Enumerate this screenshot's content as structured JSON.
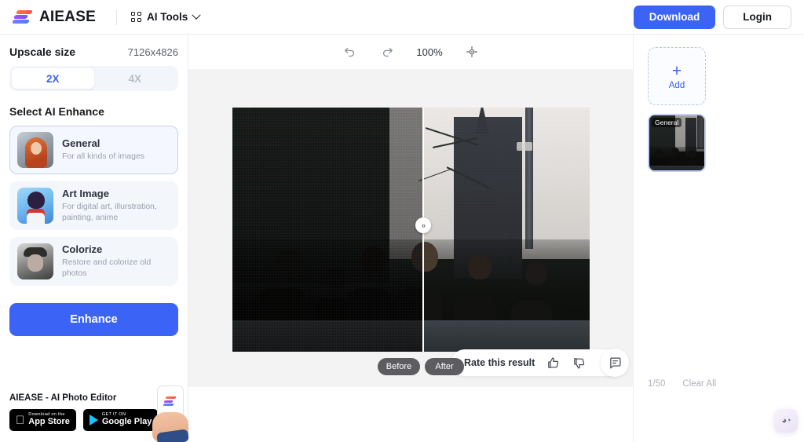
{
  "header": {
    "brand": "AIEASE",
    "logo_icon": "aiease-logo-icon",
    "ai_tools_label": "AI Tools",
    "ai_tools_icon": "grid-icon",
    "chevron_icon": "chevron-down-icon",
    "download_label": "Download",
    "login_label": "Login",
    "accent_color": "#3b64f6"
  },
  "left_panel": {
    "upscale_size_label": "Upscale size",
    "upscale_size_value": "7126x4826",
    "scale_options": [
      {
        "label": "2X",
        "selected": true
      },
      {
        "label": "4X",
        "selected": false
      }
    ],
    "select_enhance_label": "Select AI Enhance",
    "enhance_models": [
      {
        "name": "General",
        "desc": "For all kinds of images",
        "thumb_icon": "portrait-woman-thumb",
        "selected": true
      },
      {
        "name": "Art Image",
        "desc": "For digital art, illurstration, painting, anime",
        "thumb_icon": "anime-girl-thumb",
        "selected": false
      },
      {
        "name": "Colorize",
        "desc": "Restore and colorize old photos",
        "thumb_icon": "old-man-photo-thumb",
        "selected": false
      }
    ],
    "enhance_button": "Enhance",
    "promo": {
      "title": "AIEASE - AI Photo Editor",
      "app_store": {
        "small": "Download on the",
        "big": "App Store",
        "icon": "apple-icon"
      },
      "google_play": {
        "small": "GET IT ON",
        "big": "Google Play",
        "icon": "google-play-icon"
      },
      "phone_art_icon": "hand-holding-phone-icon"
    }
  },
  "canvas": {
    "toolbar": {
      "undo_icon": "undo-icon",
      "redo_icon": "redo-icon",
      "zoom_level": "100%",
      "fit_icon": "fit-to-screen-icon"
    },
    "compare": {
      "before_label": "Before",
      "after_label": "After",
      "handle_icon": "compare-slider-handle-icon"
    },
    "rate": {
      "label": "Rate this result",
      "thumbs_up_icon": "thumbs-up-icon",
      "thumbs_down_icon": "thumbs-down-icon",
      "feedback_icon": "chat-bubble-icon"
    }
  },
  "right_panel": {
    "add_label": "Add",
    "add_icon": "plus-icon",
    "thumbnail_badge": "General",
    "count": "1/50",
    "clear_all": "Clear All",
    "assistant_icon": "ai-assistant-icon"
  }
}
